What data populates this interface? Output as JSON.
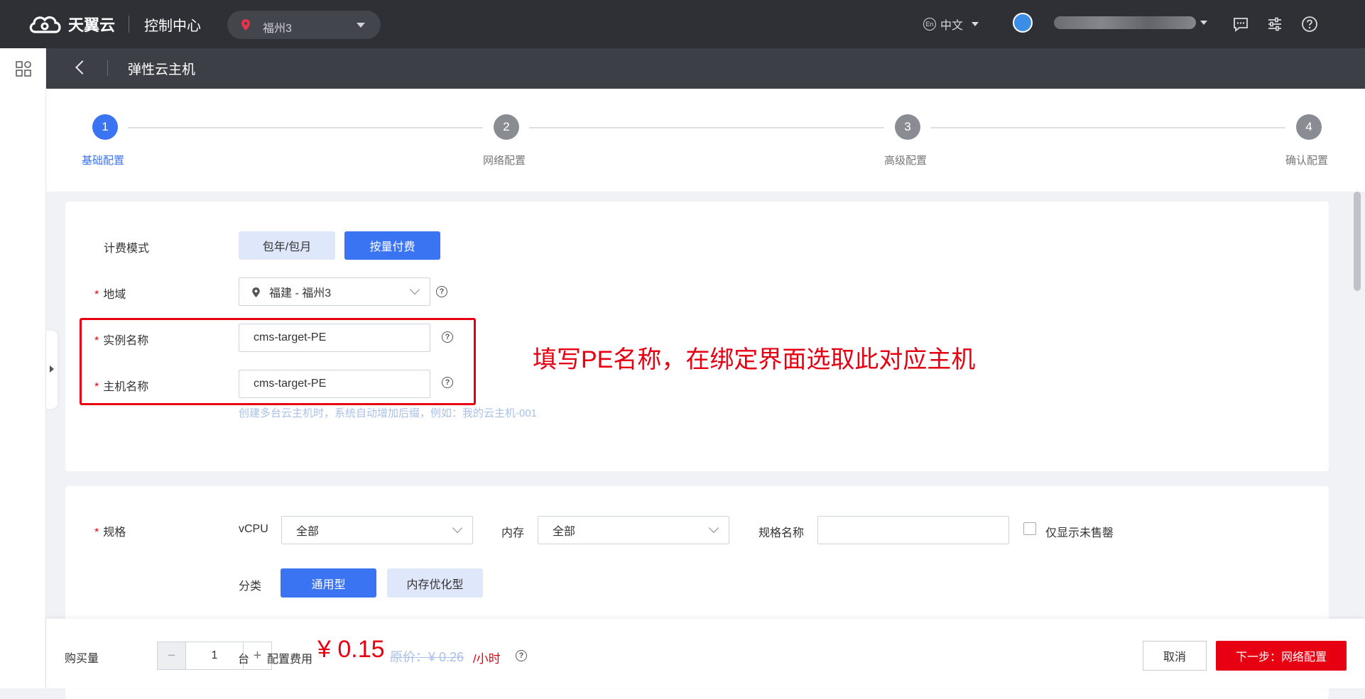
{
  "header": {
    "brand": "天翼云",
    "console_title": "控制中心",
    "region": "福州3",
    "language": "中文",
    "language_badge": "En"
  },
  "subheader": {
    "title": "弹性云主机"
  },
  "steps": [
    {
      "num": "1",
      "label": "基础配置",
      "active": true
    },
    {
      "num": "2",
      "label": "网络配置",
      "active": false
    },
    {
      "num": "3",
      "label": "高级配置",
      "active": false
    },
    {
      "num": "4",
      "label": "确认配置",
      "active": false
    }
  ],
  "billing": {
    "label": "计费模式",
    "option_yearly": "包年/包月",
    "option_usage": "按量付费"
  },
  "region_field": {
    "label": "地域",
    "value": "福建 - 福州3"
  },
  "instance_name": {
    "label": "实例名称",
    "value": "cms-target-PE"
  },
  "host_name": {
    "label": "主机名称",
    "value": "cms-target-PE"
  },
  "hint": "创建多台云主机时，系统自动增加后缀，例如：我的云主机-001",
  "annotation": "填写PE名称，在绑定界面选取此对应主机",
  "spec": {
    "label": "规格",
    "vcpu_label": "vCPU",
    "vcpu_value": "全部",
    "memory_label": "内存",
    "memory_value": "全部",
    "name_label": "规格名称",
    "name_value": "",
    "show_unsold": "仅显示未售罄",
    "category_label": "分类",
    "category_general": "通用型",
    "category_memory": "内存优化型"
  },
  "bottom": {
    "qty_label": "购买量",
    "qty_minus": "−",
    "qty_value": "1",
    "qty_plus": "+",
    "unit": "台",
    "cost_label": "配置费用",
    "price": "¥ 0.15",
    "original_price": "原价：¥ 0.26",
    "per_hour": "/小时",
    "cancel": "取消",
    "next": "下一步：网络配置"
  },
  "colors": {
    "primary": "#3a74f2",
    "danger": "#e60012",
    "topbar": "#2f3035"
  }
}
